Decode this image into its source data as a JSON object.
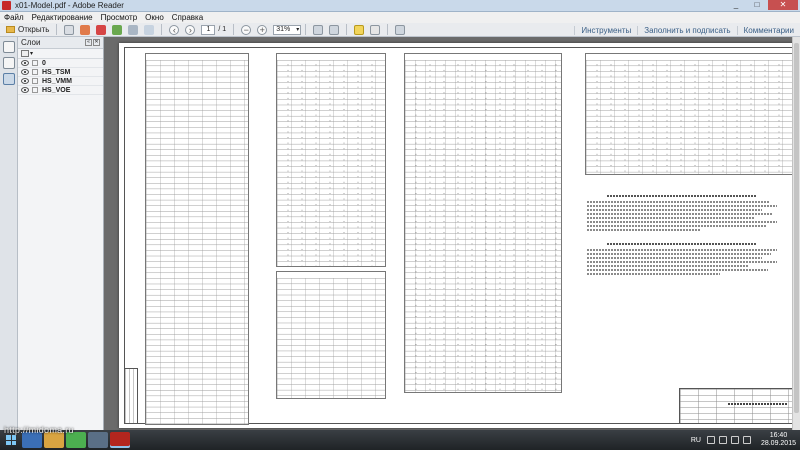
{
  "window": {
    "title": "x01-Model.pdf - Adobe Reader",
    "minimize": "_",
    "maximize": "□",
    "close": "✕"
  },
  "menu": [
    "Файл",
    "Редактирование",
    "Просмотр",
    "Окно",
    "Справка"
  ],
  "toolbar": {
    "open_label": "Открыть",
    "page_current": "1",
    "page_total": "/ 1",
    "zoom_value": "31%",
    "right_buttons": [
      "Инструменты",
      "Заполнить и подписать",
      "Комментарии"
    ]
  },
  "layers_panel": {
    "title": "Слои",
    "items": [
      "0",
      "HS_TSM",
      "HS_VMM",
      "HS_VOE"
    ]
  },
  "taskbar": {
    "language": "RU",
    "time": "16:40",
    "date": "28.09.2015"
  },
  "watermark": "http://midoma.ru",
  "colors": {
    "titlebar": "#c9d9ea",
    "toolbar": "#e9ebee",
    "doc_background": "#6b6b6b",
    "close_button": "#c75050",
    "taskbar": "#2a2e32"
  }
}
